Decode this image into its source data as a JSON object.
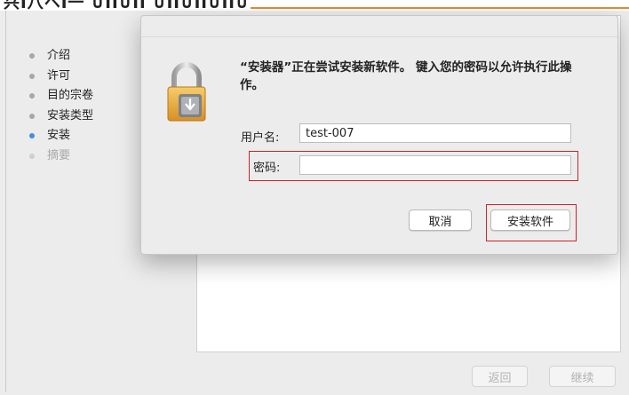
{
  "banner": {
    "text": "兴Ⅰ八ヘⅠ一 ∪ⅠⅠ∪ⅠⅠ ∪ⅠⅠ∪ⅠⅠ∪ⅠⅠ∪"
  },
  "sidebar": {
    "items": [
      {
        "label": "介绍",
        "state": "done"
      },
      {
        "label": "许可",
        "state": "done"
      },
      {
        "label": "目的宗卷",
        "state": "done"
      },
      {
        "label": "安装类型",
        "state": "done"
      },
      {
        "label": "安装",
        "state": "current"
      },
      {
        "label": "摘要",
        "state": "pending"
      }
    ]
  },
  "footer": {
    "back_label": "返回",
    "continue_label": "继续"
  },
  "dialog": {
    "message": "“安装器”正在尝试安装新软件。 键入您的密码以允许执行此操作。",
    "username_label": "用户名:",
    "username_value": "test-007",
    "password_label": "密码:",
    "password_value": "",
    "cancel_label": "取消",
    "install_label": "安装软件"
  },
  "colors": {
    "highlight": "#c9252b",
    "active_step": "#3d8ee7",
    "lock_gold": "#e2a33a"
  }
}
